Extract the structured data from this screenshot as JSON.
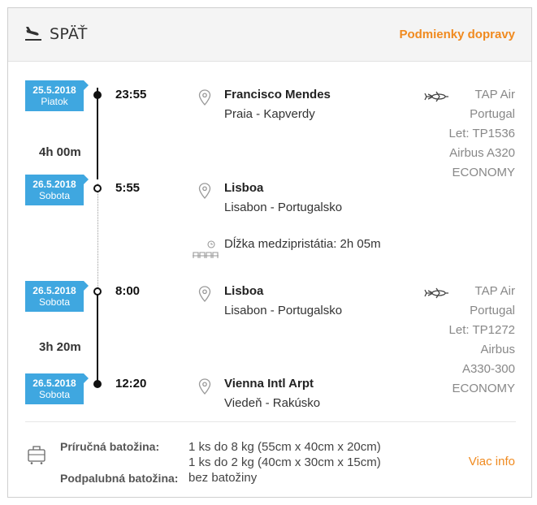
{
  "header": {
    "title": "SPÄŤ",
    "conditions_link": "Podmienky dopravy"
  },
  "segments": [
    {
      "departure": {
        "date": "25.5.2018",
        "weekday": "Piatok",
        "time": "23:55",
        "city": "Francisco Mendes",
        "location": "Praia - Kapverdy"
      },
      "duration": "4h 00m",
      "arrival": {
        "date": "26.5.2018",
        "weekday": "Sobota",
        "time": "5:55",
        "city": "Lisboa",
        "location": "Lisabon - Portugalsko"
      },
      "flight": {
        "airline_line1": "TAP Air",
        "airline_line2": "Portugal",
        "flight_no": "Let: TP1536",
        "aircraft_line1": "Airbus A320",
        "aircraft_line2": "",
        "cabin": "ECONOMY"
      }
    },
    {
      "departure": {
        "date": "26.5.2018",
        "weekday": "Sobota",
        "time": "8:00",
        "city": "Lisboa",
        "location": "Lisabon - Portugalsko"
      },
      "duration": "3h 20m",
      "arrival": {
        "date": "26.5.2018",
        "weekday": "Sobota",
        "time": "12:20",
        "city": "Vienna Intl Arpt",
        "location": "Viedeň - Rakúsko"
      },
      "flight": {
        "airline_line1": "TAP Air",
        "airline_line2": "Portugal",
        "flight_no": "Let: TP1272",
        "aircraft_line1": "Airbus",
        "aircraft_line2": "A330-300",
        "cabin": "ECONOMY"
      }
    }
  ],
  "layover": {
    "text": "Dĺžka medzipristátia: 2h 05m"
  },
  "baggage": {
    "hand_label": "Príručná batožina:",
    "hand_line1": "1 ks do 8 kg (55cm x 40cm x 20cm)",
    "hand_line2": "1 ks do 2 kg (40cm x 30cm x 15cm)",
    "hold_label": "Podpalubná batožina:",
    "hold_value": "bez batožiny",
    "more_link": "Viac info"
  },
  "colors": {
    "accent": "#f08a1f",
    "badge": "#3fa7e0"
  },
  "icons": {
    "header": "plane-landing-icon",
    "pin": "map-pin-icon",
    "plane": "plane-icon",
    "layover": "waiting-seats-icon",
    "baggage": "suitcase-icon"
  }
}
